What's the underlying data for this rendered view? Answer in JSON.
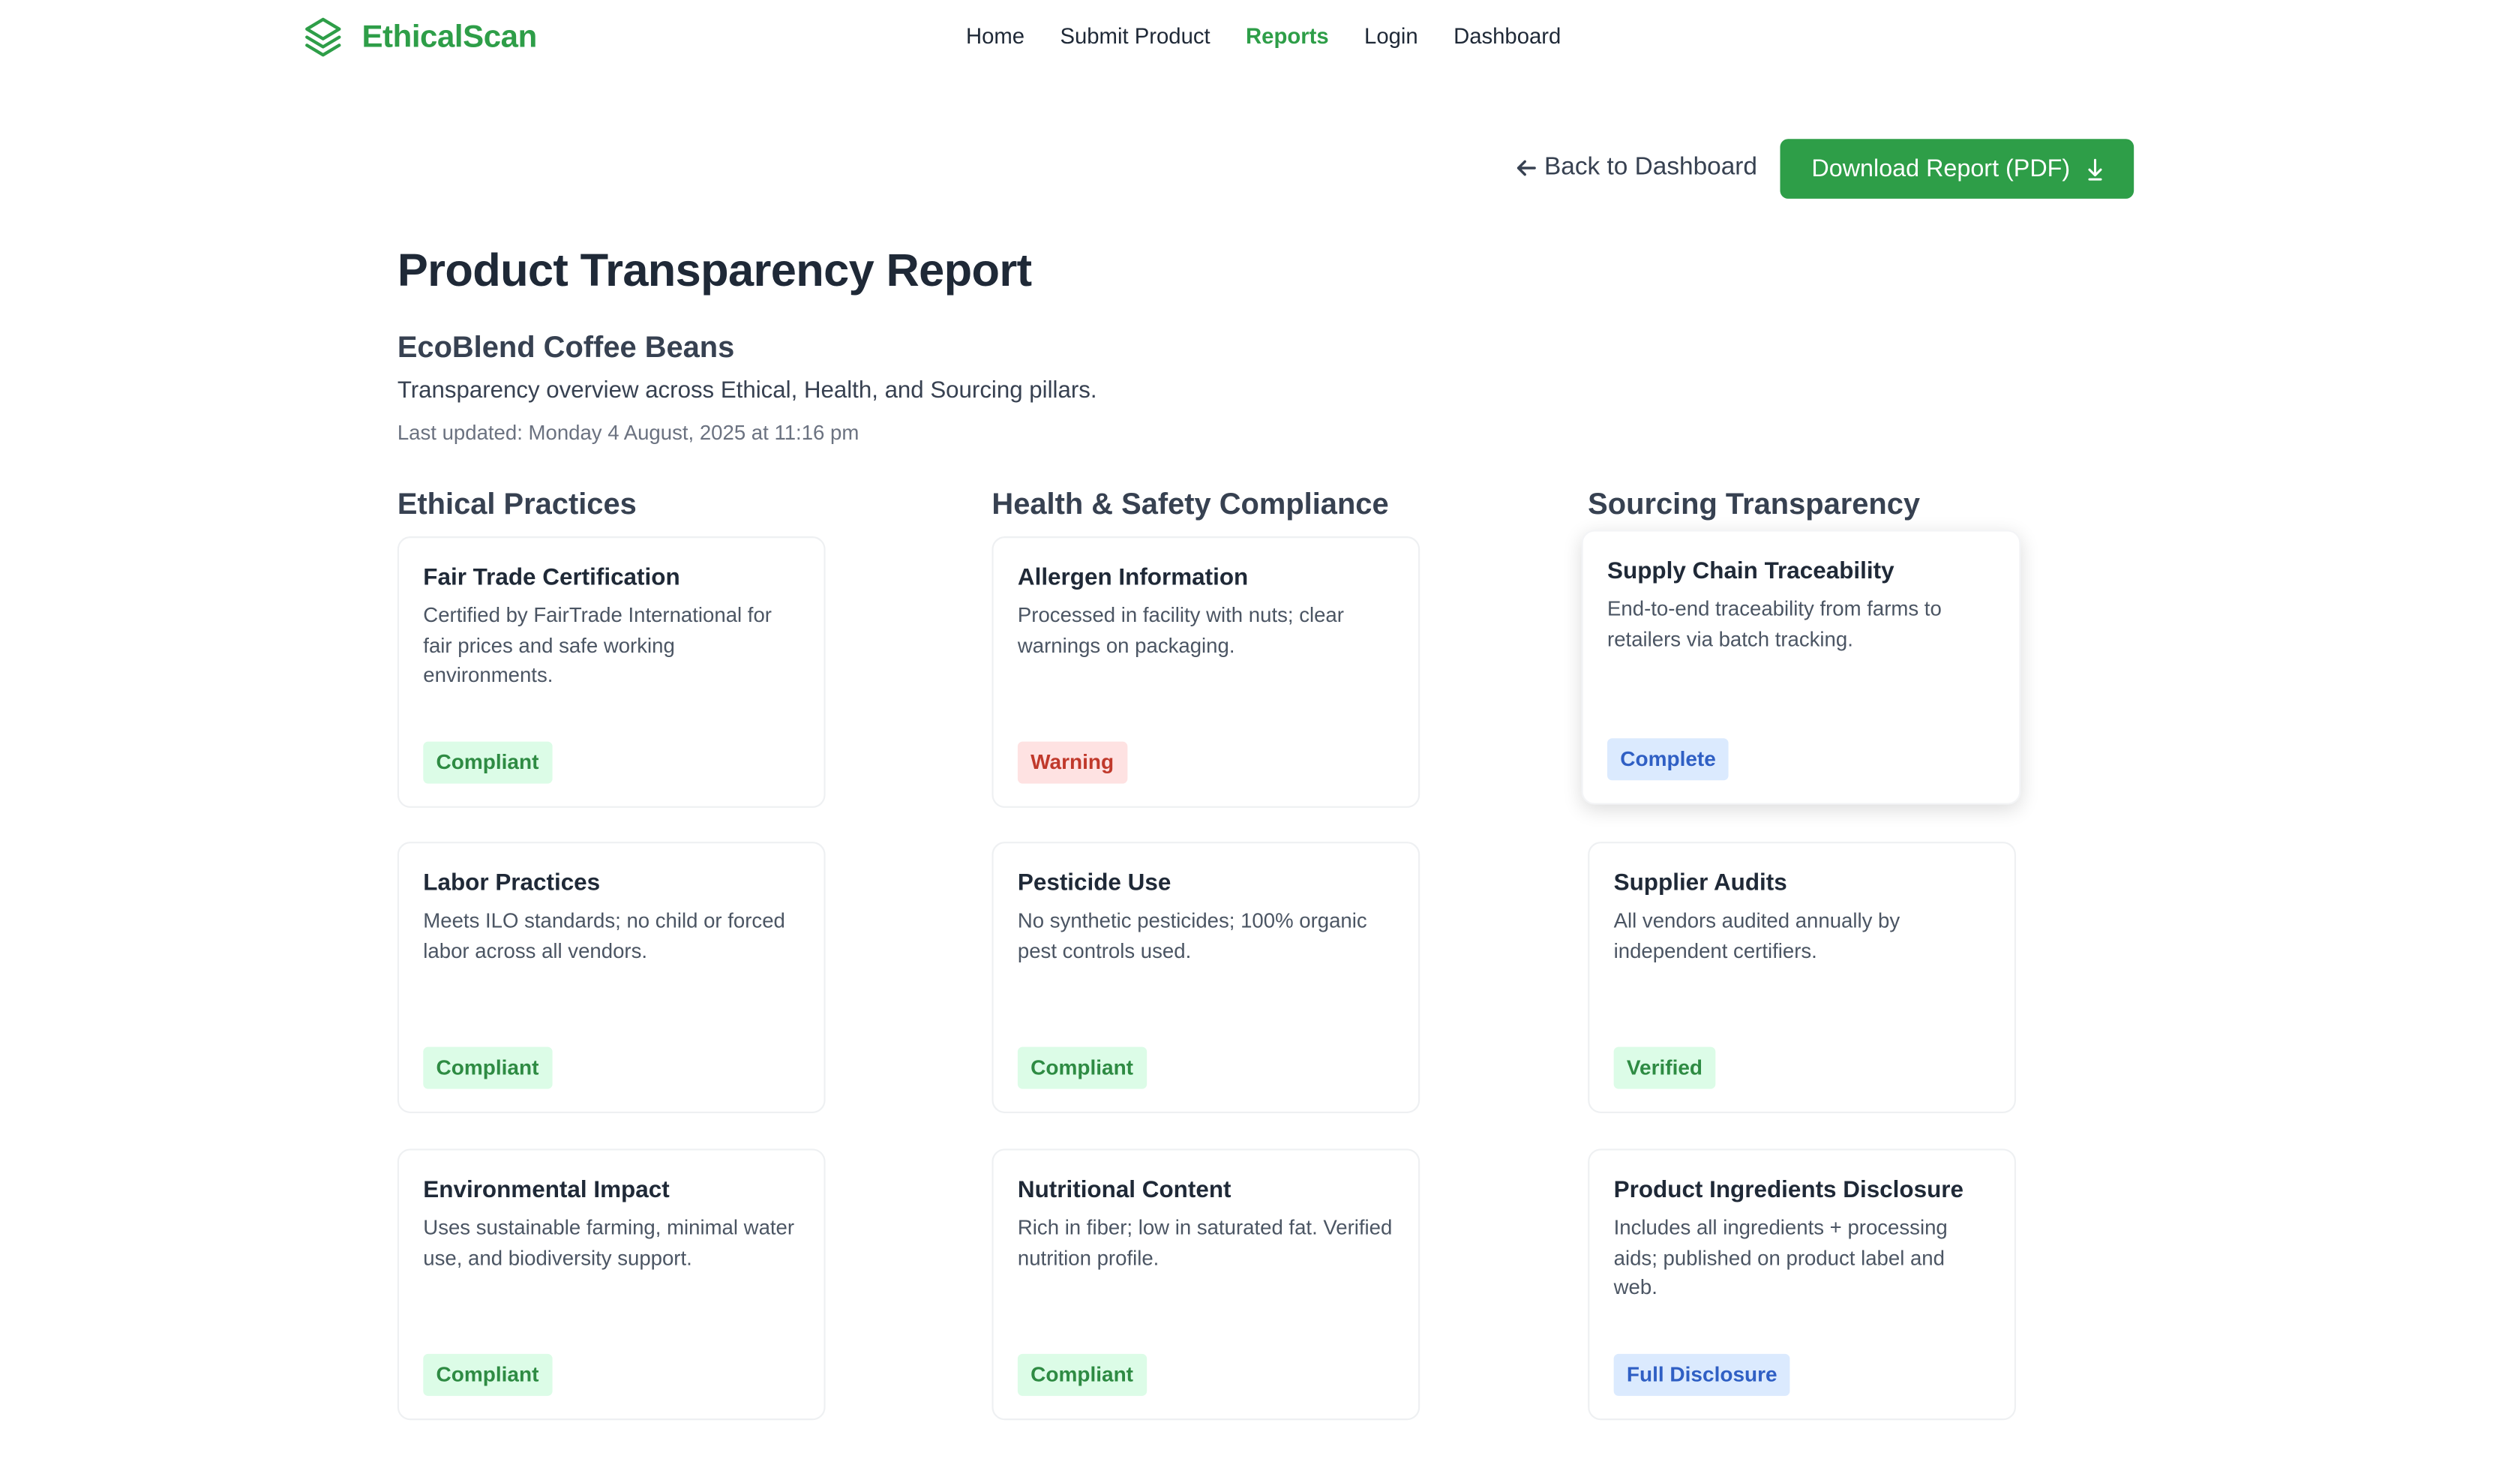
{
  "brand": {
    "name": "EthicalScan"
  },
  "nav": {
    "links": [
      {
        "label": "Home",
        "active": false
      },
      {
        "label": "Submit Product",
        "active": false
      },
      {
        "label": "Reports",
        "active": true
      },
      {
        "label": "Login",
        "active": false
      },
      {
        "label": "Dashboard",
        "active": false
      }
    ]
  },
  "actions": {
    "back_label": "Back to Dashboard",
    "download_label": "Download Report (PDF)"
  },
  "report": {
    "title": "Product Transparency Report",
    "product_name": "EcoBlend Coffee Beans",
    "overview": "Transparency overview across Ethical, Health, and Sourcing pillars.",
    "last_updated": "Last updated: Monday 4 August, 2025 at 11:16 pm"
  },
  "columns": [
    {
      "title": "Ethical Practices",
      "cards": [
        {
          "title": "Fair Trade Certification",
          "description": "Certified by FairTrade International for fair prices and safe working environments.",
          "status": "Compliant",
          "status_color": "green"
        },
        {
          "title": "Labor Practices",
          "description": "Meets ILO standards; no child or forced labor across all vendors.",
          "status": "Compliant",
          "status_color": "green"
        },
        {
          "title": "Environmental Impact",
          "description": "Uses sustainable farming, minimal water use, and biodiversity support.",
          "status": "Compliant",
          "status_color": "green"
        }
      ]
    },
    {
      "title": "Health & Safety Compliance",
      "cards": [
        {
          "title": "Allergen Information",
          "description": "Processed in facility with nuts; clear warnings on packaging.",
          "status": "Warning",
          "status_color": "red"
        },
        {
          "title": "Pesticide Use",
          "description": "No synthetic pesticides; 100% organic pest controls used.",
          "status": "Compliant",
          "status_color": "green"
        },
        {
          "title": "Nutritional Content",
          "description": "Rich in fiber; low in saturated fat. Verified nutrition profile.",
          "status": "Compliant",
          "status_color": "green"
        }
      ]
    },
    {
      "title": "Sourcing Transparency",
      "cards": [
        {
          "title": "Supply Chain Traceability",
          "description": "End-to-end traceability from farms to retailers via batch tracking.",
          "status": "Complete",
          "status_color": "blue"
        },
        {
          "title": "Supplier Audits",
          "description": "All vendors audited annually by independent certifiers.",
          "status": "Verified",
          "status_color": "green"
        },
        {
          "title": "Product Ingredients Disclosure",
          "description": "Includes all ingredients + processing aids; published on product label and web.",
          "status": "Full Disclosure",
          "status_color": "blue"
        }
      ]
    }
  ],
  "colors": {
    "brand_green": "#2e9e48",
    "text_dark": "#1f2937"
  },
  "icons": {
    "brand": "layers-icon",
    "back": "arrow-left-icon",
    "download": "download-arrow-icon"
  }
}
